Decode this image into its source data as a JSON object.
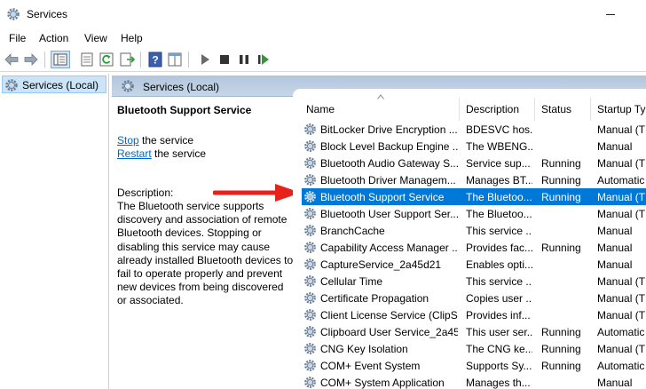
{
  "window": {
    "title": "Services"
  },
  "menu": [
    "File",
    "Action",
    "View",
    "Help"
  ],
  "toolbar": {
    "icons": [
      "back-arrow-icon",
      "forward-arrow-icon",
      "console-tree-icon",
      "properties-icon",
      "refresh-icon",
      "export-list-icon",
      "help-icon",
      "show-action-pane-icon",
      "start-service-icon",
      "stop-service-icon",
      "restart-service-icon"
    ]
  },
  "tree": {
    "root_label": "Services (Local)"
  },
  "pane_header": {
    "label": "Services (Local)"
  },
  "details": {
    "service_name": "Bluetooth Support Service",
    "stop_link": "Stop",
    "stop_suffix": " the service",
    "restart_link": "Restart",
    "restart_suffix": " the service",
    "description_label": "Description:",
    "description_text": "The Bluetooth service supports discovery and association of remote Bluetooth devices.  Stopping or disabling this service may cause already installed Bluetooth devices to fail to operate properly and prevent new devices from being discovered or associated."
  },
  "columns": {
    "name": "Name",
    "description": "Description",
    "status": "Status",
    "startup": "Startup Typ"
  },
  "rows": [
    {
      "name": "BitLocker Drive Encryption ...",
      "description": "BDESVC hos...",
      "status": "",
      "startup": "Manual (T"
    },
    {
      "name": "Block Level Backup Engine ...",
      "description": "The WBENG...",
      "status": "",
      "startup": "Manual"
    },
    {
      "name": "Bluetooth Audio Gateway S...",
      "description": "Service sup...",
      "status": "Running",
      "startup": "Manual (T"
    },
    {
      "name": "Bluetooth Driver Managem...",
      "description": "Manages BT...",
      "status": "Running",
      "startup": "Automatic"
    },
    {
      "name": "Bluetooth Support Service",
      "description": "The Bluetoo...",
      "status": "Running",
      "startup": "Manual (T",
      "selected": true
    },
    {
      "name": "Bluetooth User Support Ser...",
      "description": "The Bluetoo...",
      "status": "",
      "startup": "Manual (T"
    },
    {
      "name": "BranchCache",
      "description": "This service ...",
      "status": "",
      "startup": "Manual"
    },
    {
      "name": "Capability Access Manager ...",
      "description": "Provides fac...",
      "status": "Running",
      "startup": "Manual"
    },
    {
      "name": "CaptureService_2a45d21",
      "description": "Enables opti...",
      "status": "",
      "startup": "Manual"
    },
    {
      "name": "Cellular Time",
      "description": "This service ...",
      "status": "",
      "startup": "Manual (T"
    },
    {
      "name": "Certificate Propagation",
      "description": "Copies user ...",
      "status": "",
      "startup": "Manual (T"
    },
    {
      "name": "Client License Service (ClipS...",
      "description": "Provides inf...",
      "status": "",
      "startup": "Manual (T"
    },
    {
      "name": "Clipboard User Service_2a45...",
      "description": "This user ser...",
      "status": "Running",
      "startup": "Automatic"
    },
    {
      "name": "CNG Key Isolation",
      "description": "The CNG ke...",
      "status": "Running",
      "startup": "Manual (T"
    },
    {
      "name": "COM+ Event System",
      "description": "Supports Sy...",
      "status": "Running",
      "startup": "Automatic"
    },
    {
      "name": "COM+ System Application",
      "description": "Manages th...",
      "status": "",
      "startup": "Manual"
    }
  ],
  "colors": {
    "selection": "#0078d7",
    "link": "#0066cc",
    "arrow": "#e8221b",
    "header_band": "#b3c6dc"
  }
}
